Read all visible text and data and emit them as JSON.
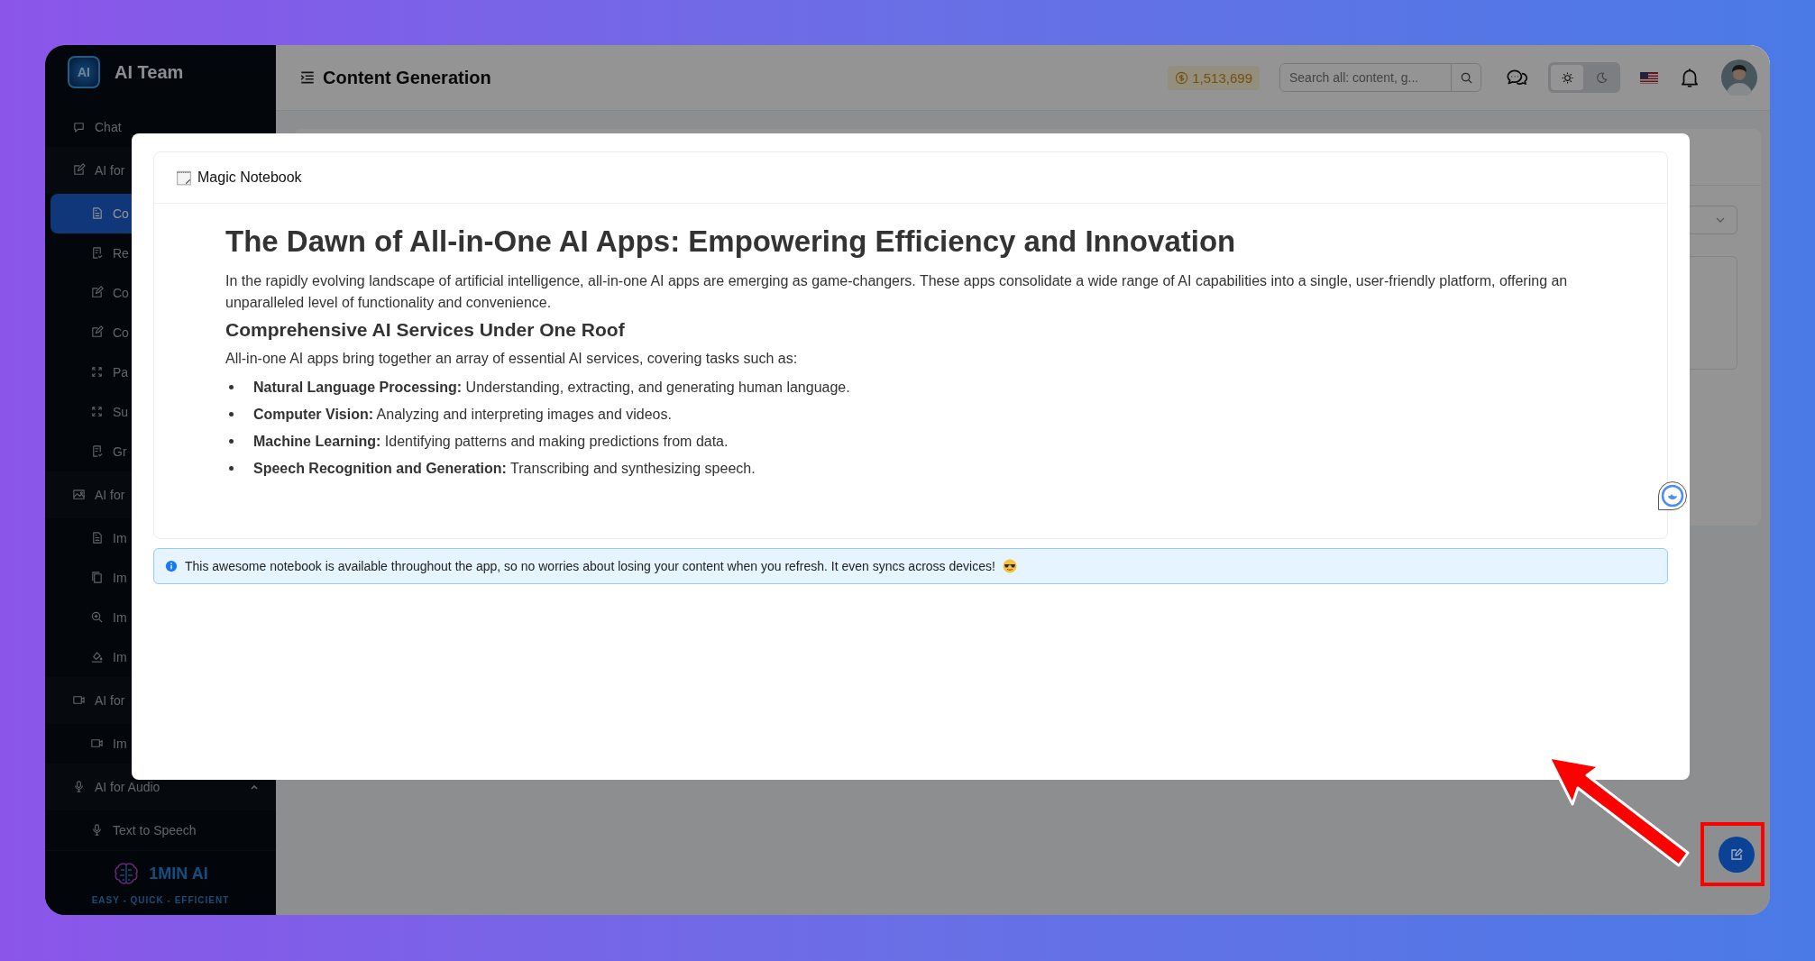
{
  "app": {
    "name": "AI Team",
    "logo_text": "AI"
  },
  "sidebar": {
    "items": [
      {
        "label": "Chat",
        "selected": false
      },
      {
        "label": "AI for",
        "children": [
          {
            "label": "Co",
            "selected": true
          },
          {
            "label": "Re",
            "selected": false
          },
          {
            "label": "Co",
            "selected": false
          },
          {
            "label": "Co",
            "selected": false
          },
          {
            "label": "Pa",
            "selected": false
          },
          {
            "label": "Su",
            "selected": false
          },
          {
            "label": "Gr",
            "selected": false
          }
        ]
      },
      {
        "label": "AI for",
        "children": [
          {
            "label": "Im",
            "selected": false
          },
          {
            "label": "Im",
            "selected": false
          },
          {
            "label": "Im",
            "selected": false
          },
          {
            "label": "Im",
            "selected": false
          }
        ]
      },
      {
        "label": "AI for",
        "children": [
          {
            "label": "Im",
            "selected": false
          }
        ]
      },
      {
        "label": "AI for Audio",
        "expanded": true,
        "children": [
          {
            "label": "Text to Speech",
            "selected": false
          }
        ]
      }
    ],
    "brand": {
      "name": "1MIN AI",
      "tagline": "EASY - QUICK - EFFICIENT"
    }
  },
  "header": {
    "title": "Content Generation",
    "credits": "1,513,699",
    "search": {
      "placeholder": "Search all: content, g..."
    },
    "theme": [
      {
        "selected": true
      },
      {
        "selected": false
      }
    ]
  },
  "notebook": {
    "title": "Magic Notebook",
    "heading": "The Dawn of All-in-One AI Apps: Empowering Efficiency and Innovation",
    "intro": "In the rapidly evolving landscape of artificial intelligence, all-in-one AI apps are emerging as game-changers. These apps consolidate a wide range of AI capabilities into a single, user-friendly platform, offering an unparalleled level of functionality and convenience.",
    "subheading": "Comprehensive AI Services Under One Roof",
    "lead": "All-in-one AI apps bring together an array of essential AI services, covering tasks such as:",
    "bullets": [
      "**Natural Language Processing:** Understanding, extracting, and generating human language.",
      "**Computer Vision:** Analyzing and interpreting images and videos.",
      "**Machine Learning:** Identifying patterns and making predictions from data.",
      "**Speech Recognition and Generation:** Transcribing and synthesizing speech."
    ],
    "notice": "This awesome notebook is available throughout the app, so no worries about losing your content when you refresh. It even syncs across devices!"
  }
}
